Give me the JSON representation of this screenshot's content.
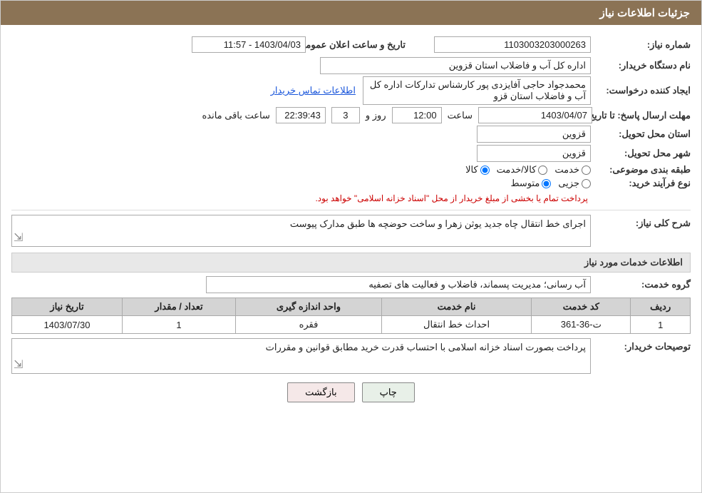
{
  "header": {
    "title": "جزئیات اطلاعات نیاز"
  },
  "fields": {
    "shomara_niaz_label": "شماره نیاز:",
    "shomara_niaz_value": "1103003203000263",
    "dastgah_label": "نام دستگاه خریدار:",
    "dastgah_value": "اداره کل آب و فاضلاب استان قزوین",
    "ijad_label": "ایجاد کننده درخواست:",
    "ijad_value": "محمدجواد حاجی آفایزدی پور کارشناس تدارکات اداره کل آب و فاضلاب استان قزو",
    "ijad_link": "اطلاعات تماس خریدار",
    "mohlat_label": "مهلت ارسال پاسخ: تا تاریخ:",
    "tarikh_value": "1403/04/07",
    "saat_label": "ساعت",
    "saat_value": "12:00",
    "roz_label": "روز و",
    "roz_value": "3",
    "baqi_label": "ساعت باقی مانده",
    "baqi_value": "22:39:43",
    "tarikh_elaan_label": "تاریخ و ساعت اعلان عمومی:",
    "tarikh_elaan_value": "1403/04/03 - 11:57",
    "ostan_tahvil_label": "استان محل تحویل:",
    "ostan_tahvil_value": "قزوین",
    "shahr_tahvil_label": "شهر محل تحویل:",
    "shahr_tahvil_value": "قزوین",
    "tabaqe_label": "طبقه بندی موضوعی:",
    "tabaqe_options": [
      "خدمت",
      "کالا/خدمت",
      "کالا"
    ],
    "tabaqe_selected": "کالا",
    "farayand_label": "نوع فرآیند خرید:",
    "farayand_options": [
      "جزیی",
      "متوسط"
    ],
    "farayand_selected": "متوسط",
    "farayand_note": "پرداخت تمام یا بخشی از مبلغ خریدار از محل \"اسناد خزانه اسلامی\" خواهد بود.",
    "sharh_label": "شرح کلی نیاز:",
    "sharh_value": "اجرای خط انتقال چاه جدید یوثن زهرا و ساخت حوضچه ها طبق مدارک پیوست",
    "khadamat_label": "اطلاعات خدمات مورد نیاز",
    "goroh_label": "گروه خدمت:",
    "goroh_value": "آب رسانی؛ مدیریت پسماند، فاضلاب و فعالیت های تصفیه",
    "table": {
      "headers": [
        "ردیف",
        "کد خدمت",
        "نام خدمت",
        "واحد اندازه گیری",
        "تعداد / مقدار",
        "تاریخ نیاز"
      ],
      "rows": [
        {
          "radif": "1",
          "kod": "ت-36-361",
          "name": "احداث خط انتقال",
          "vahed": "فقره",
          "tedad": "1",
          "tarikh": "1403/07/30"
        }
      ]
    },
    "tosif_label": "توصیحات خریدار:",
    "tosif_value": "پرداخت بصورت اسناد خزانه اسلامی با احتساب قدرت خرید مطابق قوانین و مقررات",
    "btn_print": "چاپ",
    "btn_back": "بازگشت"
  }
}
